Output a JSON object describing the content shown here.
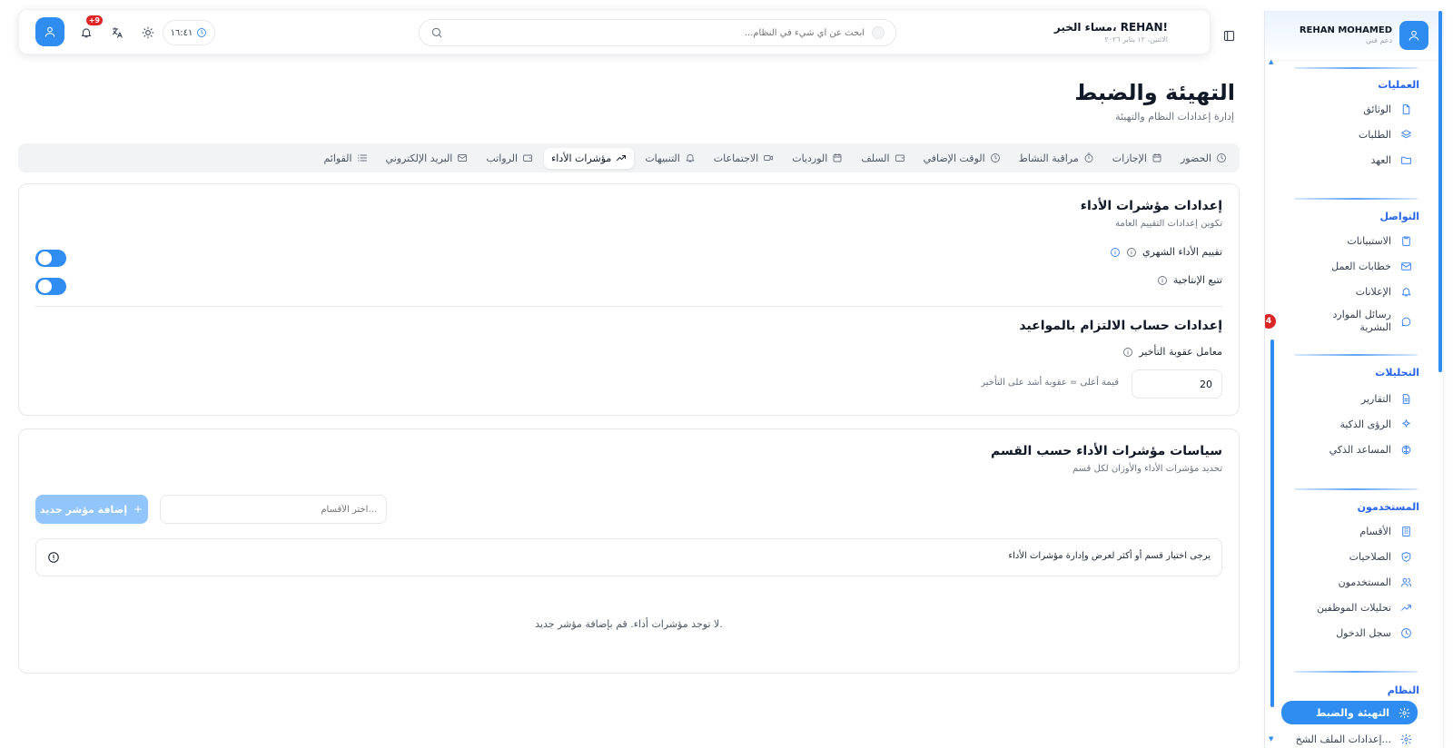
{
  "sidebar": {
    "user_name": "REHAN MOHAMED",
    "user_role": "دعم فني",
    "sections": {
      "operations": "العمليات",
      "communication": "التواصل",
      "analytics": "التحليلات",
      "users": "المستخدمون",
      "system": "النظام"
    },
    "items": {
      "documents": "الوثائق",
      "requests": "الطلبات",
      "custody": "العهد",
      "surveys": "الاستبيانات",
      "work_letters": "خطابات العمل",
      "announcements": "الإعلانات",
      "hr_messages": "رسائل الموارد البشرية",
      "hr_messages_badge": "4",
      "reports": "التقارير",
      "smart_insights": "الرؤى الذكية",
      "ai_assistant": "المساعد الذكي",
      "departments": "الأقسام",
      "permissions": "الصلاحيات",
      "users": "المستخدمون",
      "employee_analytics": "تحليلات الموظفين",
      "login_log": "سجل الدخول",
      "configuration": "التهيئة والضبط",
      "profile_settings": "إعدادات الملف الشخ..."
    }
  },
  "header": {
    "greeting": "مساء الخير، REHAN!",
    "date": "الاثنين، ١٢ يناير ٢٠٢٦",
    "search_placeholder": "ابحث عن أي شيء في النظام...",
    "clock": "١٦:٤١",
    "notif_badge": "+9"
  },
  "page": {
    "title": "التهيئة والضبط",
    "subtitle": "إدارة إعدادات النظام والتهيئة"
  },
  "tabs": [
    {
      "label": "الحضور",
      "icon": "clock-icon"
    },
    {
      "label": "الإجازات",
      "icon": "calendar-icon"
    },
    {
      "label": "مراقبة النشاط",
      "icon": "timer-icon"
    },
    {
      "label": "الوقت الإضافي",
      "icon": "clock-icon"
    },
    {
      "label": "السلف",
      "icon": "wallet-icon"
    },
    {
      "label": "الورديات",
      "icon": "calendar-icon"
    },
    {
      "label": "الاجتماعات",
      "icon": "video-icon"
    },
    {
      "label": "التنبيهات",
      "icon": "bell-icon"
    },
    {
      "label": "مؤشرات الأداء",
      "icon": "trending-up-icon"
    },
    {
      "label": "الرواتب",
      "icon": "wallet-icon"
    },
    {
      "label": "البريد الإلكتروني",
      "icon": "mail-icon"
    },
    {
      "label": "القوائم",
      "icon": "list-icon"
    }
  ],
  "active_tab": "مؤشرات الأداء",
  "kpi_settings": {
    "title": "إعدادات مؤشرات الأداء",
    "subtitle": "تكوين إعدادات التقييم العامة",
    "monthly_eval_label": "تقييم الأداء الشهري",
    "monthly_eval_on": true,
    "productivity_label": "تتبع الإنتاجية",
    "productivity_on": true
  },
  "punctuality": {
    "title": "إعدادات حساب الالتزام بالمواعيد",
    "penalty_label": "معامل عقوبة التأخير",
    "penalty_value": "20",
    "penalty_hint": "قيمة أعلى = عقوبة أشد على التأخير"
  },
  "dept_policies": {
    "title": "سياسات مؤشرات الأداء حسب القسم",
    "subtitle": "تحديد مؤشرات الأداء والأوزان لكل قسم",
    "select_placeholder": "اختر الأقسام...",
    "add_button": "إضافة مؤشر جديد",
    "alert": "يرجى اختيار قسم أو أكثر لعرض وإدارة مؤشرات الأداء",
    "empty": "لا توجد مؤشرات أداء. قم بإضافة مؤشر جديد."
  },
  "colors": {
    "accent": "#2f8cf0",
    "badge": "#dc2626"
  }
}
